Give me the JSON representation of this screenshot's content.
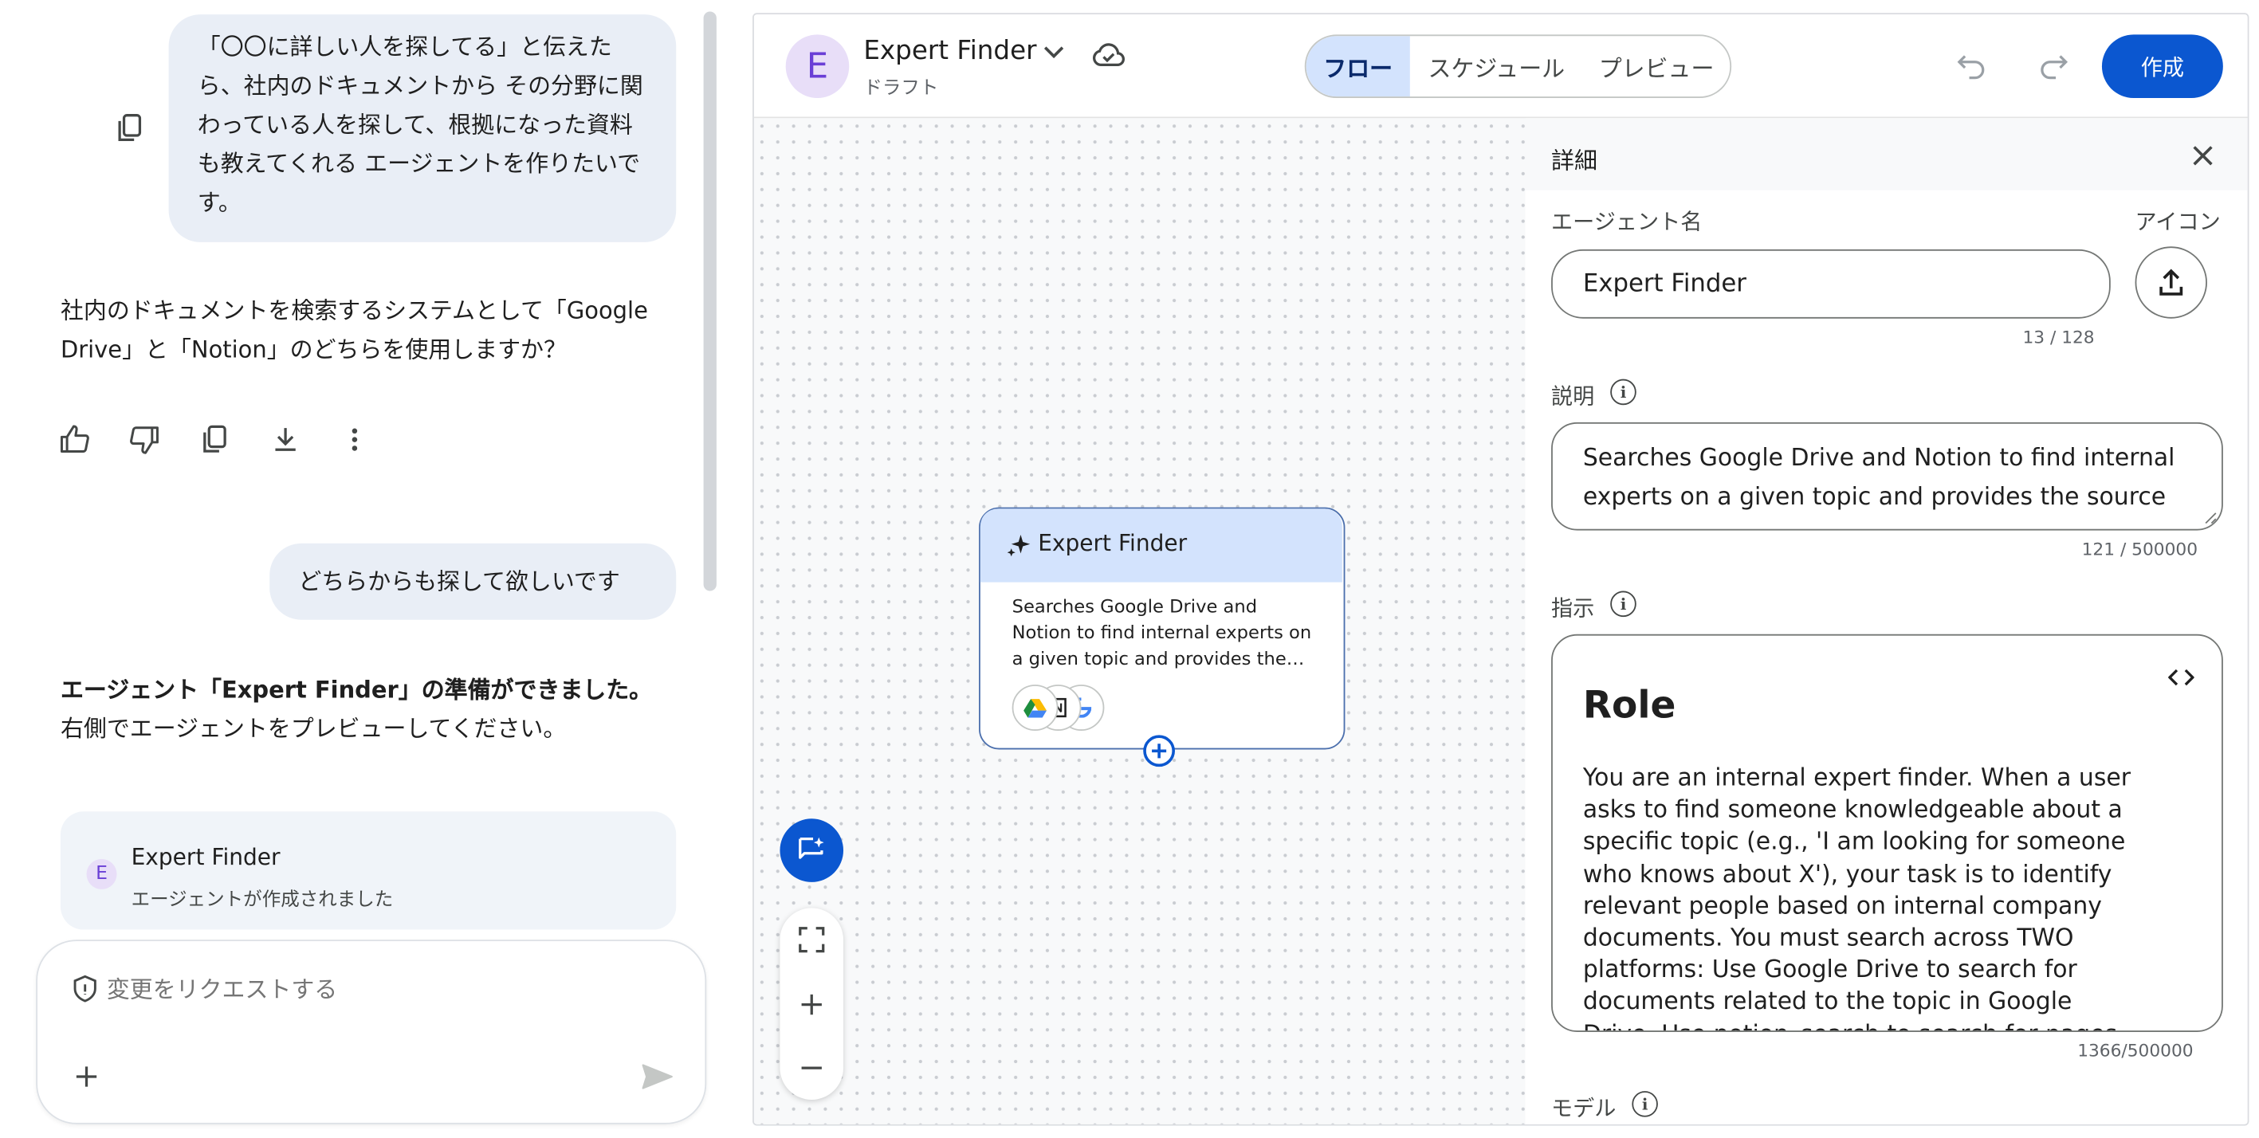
{
  "chat": {
    "user_message_1": "「〇〇に詳しい人を探してる」と伝えたら、社内のドキュメントから その分野に関わっている人を探して、根拠になった資料も教えてくれる エージェントを作りたいです。",
    "assistant_message_1": "社内のドキュメントを検索するシステムとして「Google Drive」と「Notion」のどちらを使用しますか？",
    "user_message_2": "どちらからも探して欲しいです",
    "assistant_message_2_bold": "エージェント「Expert Finder」の準備ができました。",
    "assistant_message_2_text": "右側でエージェントをプレビューしてください。",
    "agent_card": {
      "avatar_letter": "E",
      "title": "Expert Finder",
      "subtitle": "エージェントが作成されました"
    },
    "composer": {
      "placeholder": "変更をリクエストする"
    }
  },
  "header": {
    "avatar_letter": "E",
    "title": "Expert Finder",
    "status": "ドラフト",
    "tabs": [
      "フロー",
      "スケジュール",
      "プレビュー"
    ],
    "active_tab": 0,
    "create_button": "作成"
  },
  "canvas": {
    "node": {
      "title": "Expert Finder",
      "description": "Searches Google Drive and Notion to find internal experts on a given topic and provides the…"
    }
  },
  "details": {
    "heading": "詳細",
    "agent_name_label": "エージェント名",
    "icon_label": "アイコン",
    "agent_name_value": "Expert Finder",
    "agent_name_counter": "13 / 128",
    "description_label": "説明",
    "description_value": "Searches Google Drive and Notion to find internal experts on a given topic and provides the source",
    "description_counter": "121 / 500000",
    "instructions_label": "指示",
    "instructions_heading": "Role",
    "instructions_body": "You are an internal expert finder. When a user asks to find someone knowledgeable about a specific topic (e.g., 'I am looking for someone who knows about X'), your task is to identify relevant people based on internal company documents. You must search across TWO platforms: Use Google Drive to search for documents related to the topic in Google Drive. Use notion_search to search for pages and",
    "instructions_counter": "1366/500000",
    "model_label": "モデル"
  },
  "colors": {
    "accent": "#0b57d0",
    "avatar_bg": "#e8def8",
    "avatar_fg": "#6a3fd6",
    "bubble_bg": "#e9eef6",
    "tab_active_bg": "#d3e3fd",
    "node_header_bg": "#d3e3fd"
  },
  "icons": [
    "copy-icon",
    "thumb-up-icon",
    "thumb-down-icon",
    "download-icon",
    "more-vert-icon",
    "shield-icon",
    "plus-icon",
    "send-icon",
    "chevron-down-icon",
    "cloud-done-icon",
    "undo-icon",
    "redo-icon",
    "close-icon",
    "upload-icon",
    "info-icon",
    "code-icon",
    "sparkle-icon",
    "google-drive-icon",
    "notion-icon",
    "google-icon",
    "add-circle-icon",
    "ai-chat-icon",
    "fullscreen-icon",
    "zoom-in-icon",
    "zoom-out-icon"
  ]
}
